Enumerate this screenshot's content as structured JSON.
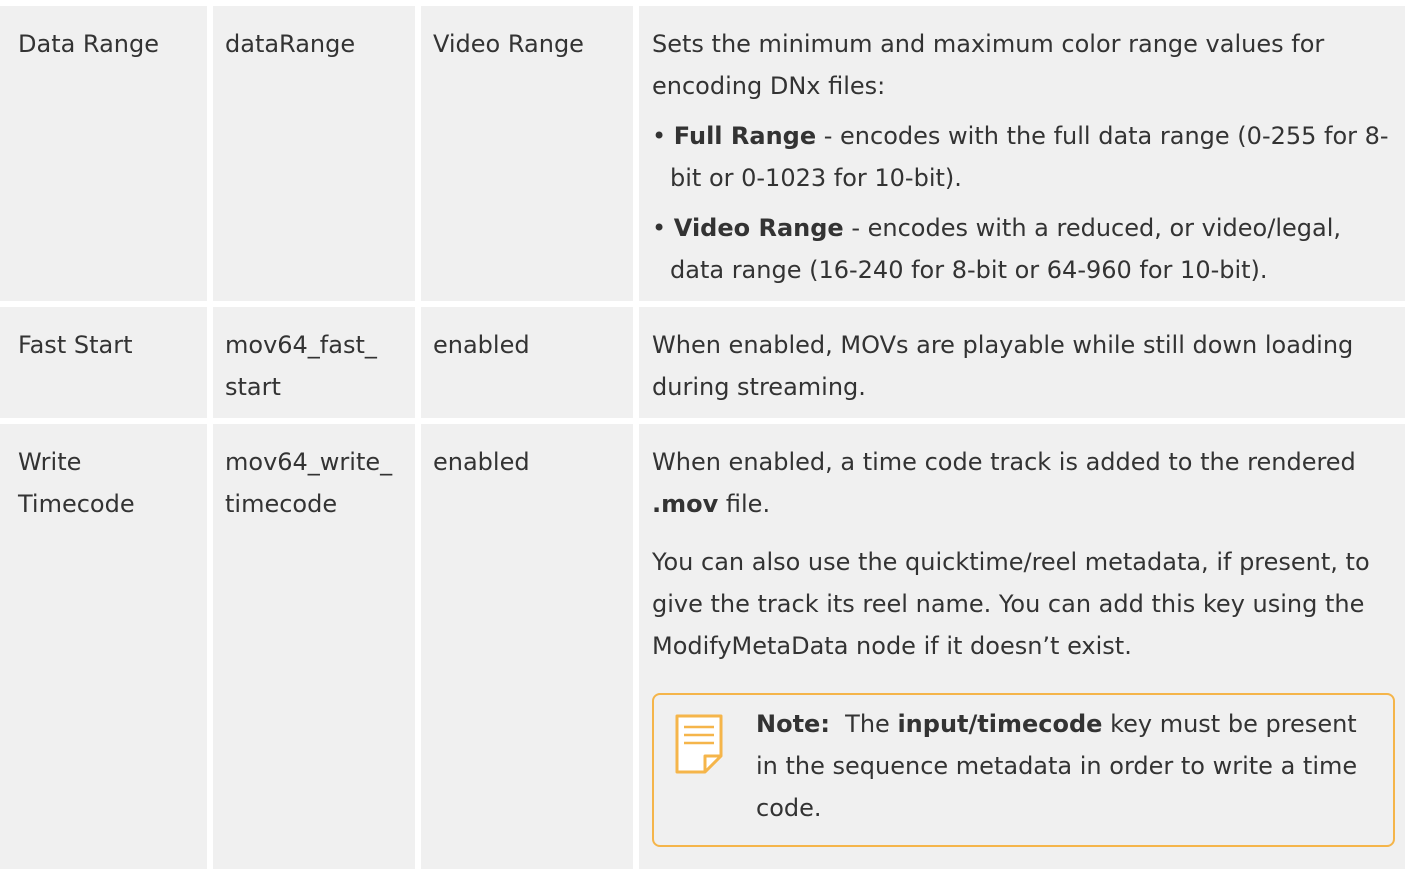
{
  "rows": [
    {
      "label": "Data Range",
      "key": "dataRange",
      "default": "Video Range",
      "desc_intro": "Sets the minimum and maximum color range values for encoding DNx files:",
      "bullets": [
        {
          "bold": "Full Range",
          "text": " - encodes with the full data range (0-255 for 8-bit or 0-1023 for 10-bit)."
        },
        {
          "bold": "Video Range",
          "text": " - encodes with a reduced, or video/legal, data range (16-240 for 8-bit or 64-960 for 10-bit)."
        }
      ]
    },
    {
      "label": "Fast Start",
      "key": "mov64_fast_ start",
      "default": "enabled",
      "desc": "When enabled, MOVs are playable while still down loading during streaming."
    },
    {
      "label": "Write Timecode",
      "key": "mov64_write_ timecode",
      "default": "enabled",
      "desc_pre": "When enabled, a time code track is added to the rendered ",
      "desc_bold": ".mov",
      "desc_post": " file.",
      "desc2": "You can also use the quicktime/reel metadata, if present, to give the track its reel name. You can add this key using the ModifyMetaData node if it doesn’t exist.",
      "note": {
        "label": "Note:",
        "pre": "  The ",
        "bold": "input/timecode",
        "post": " key must be present in the sequence metadata in order to write a time code.",
        "icon": "note-icon"
      }
    }
  ],
  "colors": {
    "cell_bg": "#f0f0f0",
    "note_border": "#f5b54a"
  }
}
